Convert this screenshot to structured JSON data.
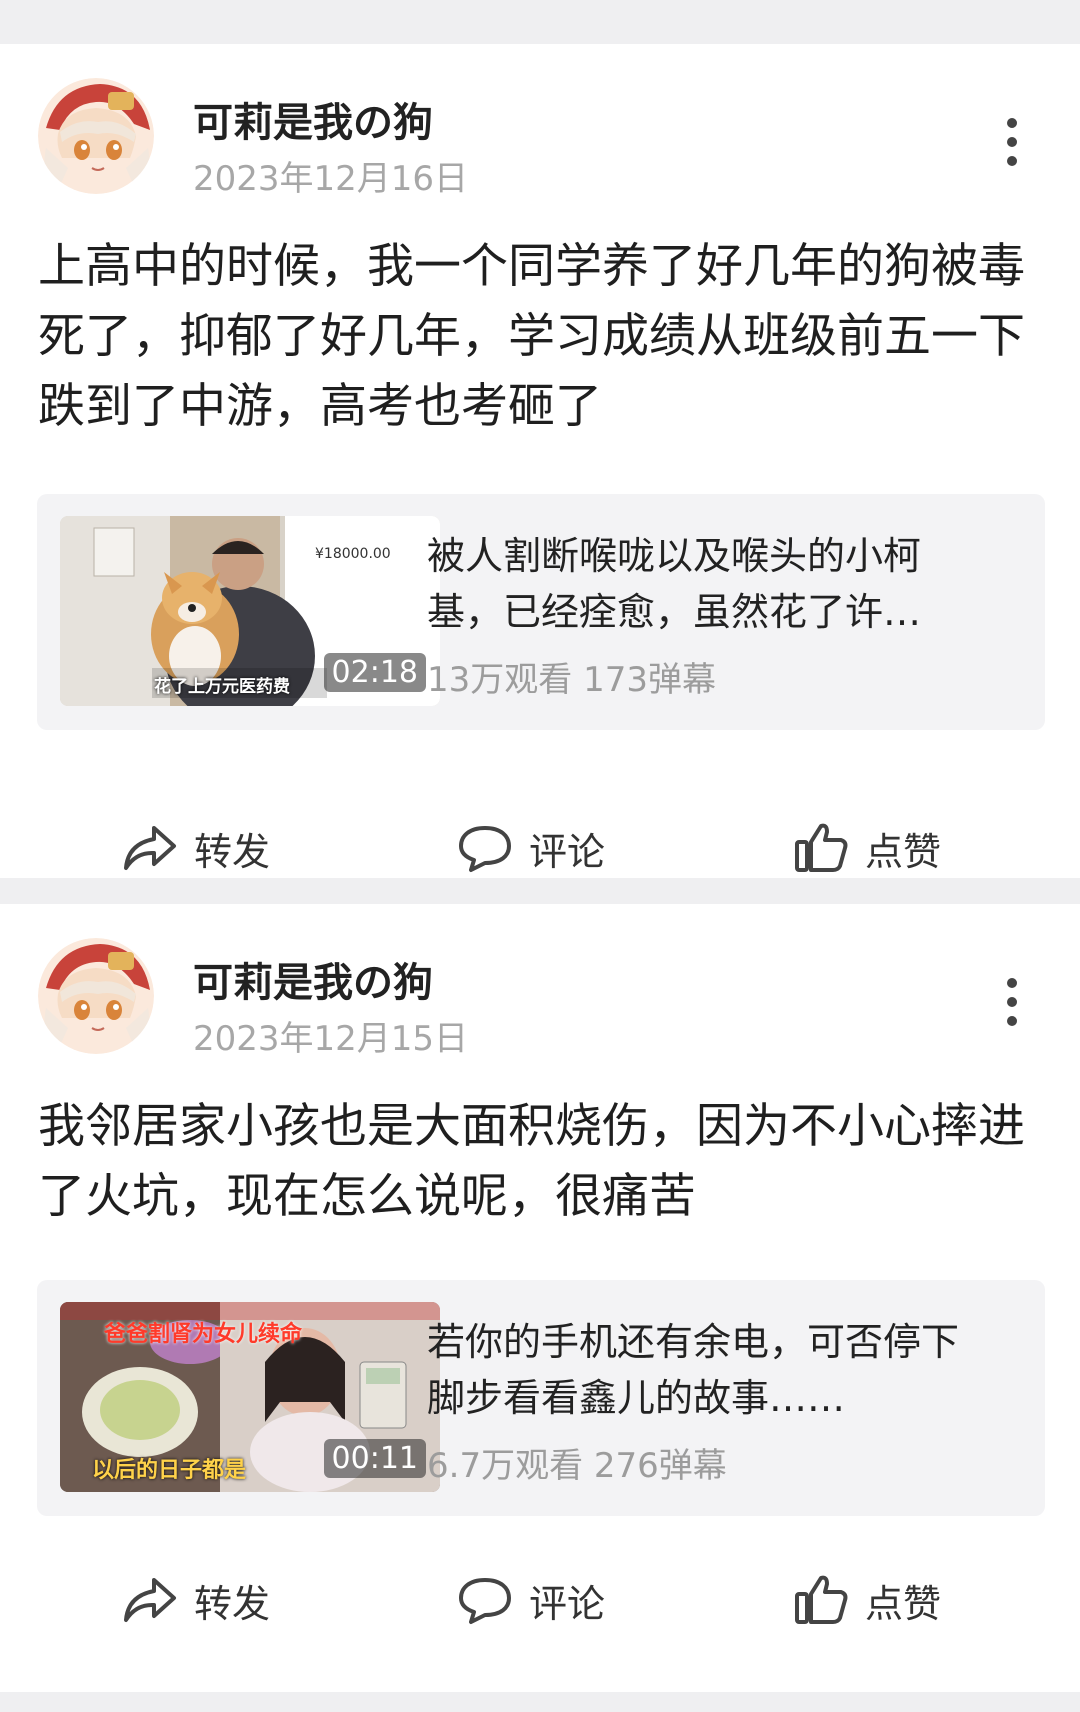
{
  "posts": [
    {
      "author": "可莉是我の狗",
      "date": "2023年12月16日",
      "text": "上高中的时候，我一个同学养了好几年的狗被毒死了，抑郁了好几年，学习成绩从班级前五一下跌到了中游，高考也考砸了",
      "video": {
        "title": "被人割断喉咙以及喉头的小柯基，已经痊愈，虽然花了许…",
        "meta": "13万观看 173弹幕",
        "duration": "02:18",
        "thumb_caption": "花了上万元医药费",
        "thumb_amount": "¥18000.00"
      },
      "actions": {
        "share": "转发",
        "comment": "评论",
        "like": "点赞"
      }
    },
    {
      "author": "可莉是我の狗",
      "date": "2023年12月15日",
      "text": "我邻居家小孩也是大面积烧伤，因为不小心摔进了火坑，现在怎么说呢，很痛苦",
      "video": {
        "title": "若你的手机还有余电，可否停下脚步看看鑫儿的故事……",
        "meta": "6.7万观看 276弹幕",
        "duration": "00:11",
        "thumb_caption_top": "爸爸割肾为女儿续命",
        "thumb_caption_bottom": "以后的日子都是"
      },
      "actions": {
        "share": "转发",
        "comment": "评论",
        "like": "点赞"
      }
    }
  ],
  "colors": {
    "background": "#efeff1",
    "card": "#ffffff",
    "meta": "#a7a7a7"
  }
}
